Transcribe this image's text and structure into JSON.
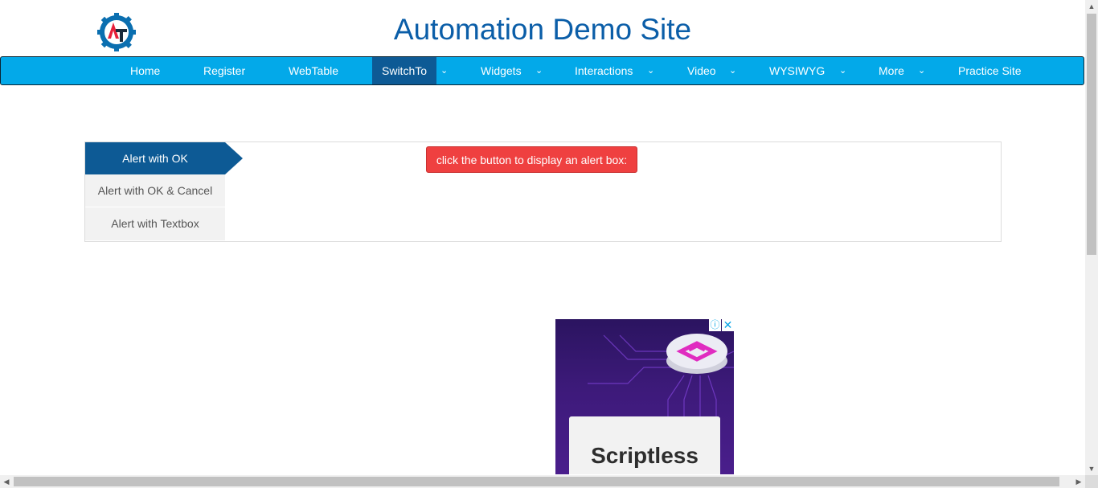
{
  "header": {
    "title": "Automation Demo Site"
  },
  "nav": {
    "items": [
      {
        "label": "Home"
      },
      {
        "label": "Register"
      },
      {
        "label": "WebTable"
      },
      {
        "label": "SwitchTo"
      },
      {
        "label": "Widgets"
      },
      {
        "label": "Interactions"
      },
      {
        "label": "Video"
      },
      {
        "label": "WYSIWYG"
      },
      {
        "label": "More"
      },
      {
        "label": "Practice Site"
      }
    ],
    "active": "SwitchTo"
  },
  "tabs": [
    {
      "label": "Alert with OK",
      "active": true
    },
    {
      "label": "Alert with OK & Cancel",
      "active": false
    },
    {
      "label": "Alert with Textbox",
      "active": false
    }
  ],
  "alert_button": {
    "label": "click the button to display an alert box:"
  },
  "ad": {
    "headline": "Scriptless"
  },
  "colors": {
    "title": "#0b5ea8",
    "navbar": "#03a9e9",
    "nav_active": "#0d5a95",
    "alert_button": "#ef4040"
  }
}
